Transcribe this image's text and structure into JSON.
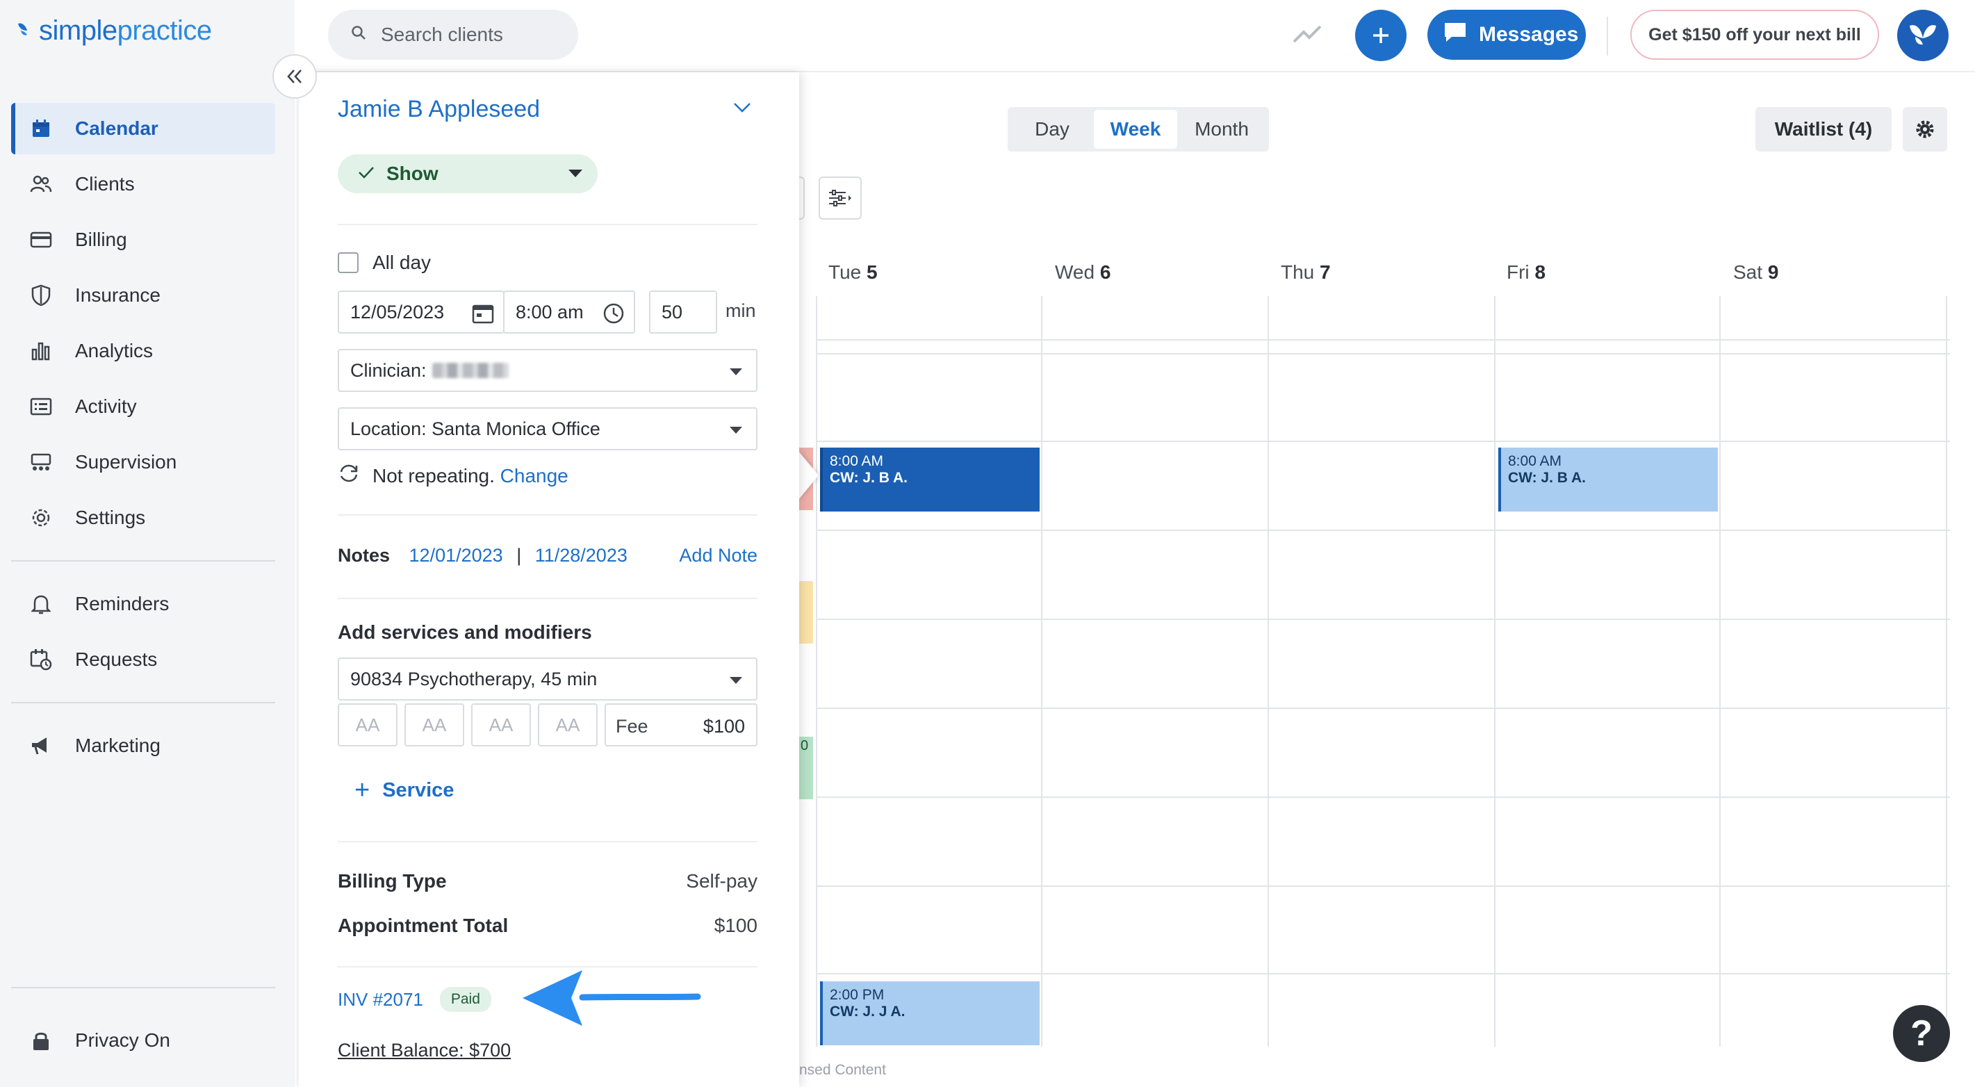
{
  "app": {
    "logo_text_a": "simple",
    "logo_text_b": "practice"
  },
  "sidebar": {
    "items": [
      {
        "label": "Calendar",
        "icon": "calendar-icon",
        "active": true
      },
      {
        "label": "Clients",
        "icon": "users-icon"
      },
      {
        "label": "Billing",
        "icon": "credit-card-icon"
      },
      {
        "label": "Insurance",
        "icon": "shield-icon"
      },
      {
        "label": "Analytics",
        "icon": "bar-chart-icon"
      },
      {
        "label": "Activity",
        "icon": "list-icon"
      },
      {
        "label": "Supervision",
        "icon": "supervision-icon"
      },
      {
        "label": "Settings",
        "icon": "gear-icon"
      }
    ],
    "secondary": [
      {
        "label": "Reminders",
        "icon": "bell-icon"
      },
      {
        "label": "Requests",
        "icon": "calendar-clock-icon"
      }
    ],
    "tertiary": [
      {
        "label": "Marketing",
        "icon": "megaphone-icon"
      }
    ],
    "privacy_label": "Privacy On"
  },
  "topbar": {
    "search_placeholder": "Search clients",
    "messages_label": "Messages",
    "promo_label": "Get $150 off your next bill"
  },
  "calendar": {
    "views": [
      "Day",
      "Week",
      "Month"
    ],
    "selected_view": "Week",
    "waitlist_label": "Waitlist (4)",
    "days": [
      {
        "dow": "Tue",
        "num": "5"
      },
      {
        "dow": "Wed",
        "num": "6"
      },
      {
        "dow": "Thu",
        "num": "7"
      },
      {
        "dow": "Fri",
        "num": "8"
      },
      {
        "dow": "Sat",
        "num": "9"
      }
    ],
    "events": [
      {
        "time": "8:00 AM",
        "name": "CW: J. B A.",
        "day": "Tue",
        "style": "dark"
      },
      {
        "time": "8:00 AM",
        "name": "CW: J. B A.",
        "day": "Fri",
        "style": "light"
      },
      {
        "time": "2:00 PM",
        "name": "CW: J. J A.",
        "day": "Tue",
        "style": "light"
      }
    ],
    "partial_event_digit": "0",
    "footer_text": "nsed Content",
    "colors": {
      "event_dark": "#1a5fb3",
      "event_light": "#a9cdf0",
      "strip_red": "#f0b1aa",
      "strip_yellow": "#fbe3a8",
      "strip_green": "#b6e3c7"
    }
  },
  "appointment": {
    "client_name": "Jamie B Appleseed",
    "status": "Show",
    "all_day_label": "All day",
    "date": "12/05/2023",
    "time": "8:00 am",
    "duration": "50",
    "duration_unit": "min",
    "clinician_label": "Clinician:",
    "location": "Location: Santa Monica Office",
    "repeat_text": "Not repeating.",
    "repeat_link": "Change",
    "notes_label": "Notes",
    "note_date_1": "12/01/2023",
    "note_sep": "|",
    "note_date_2": "11/28/2023",
    "add_note": "Add Note",
    "services_title": "Add services and modifiers",
    "service": "90834 Psychotherapy, 45 min",
    "modifiers": [
      "AA",
      "AA",
      "AA",
      "AA"
    ],
    "fee_label": "Fee",
    "fee_value": "$100",
    "add_service_label": "Service",
    "billing_type_label": "Billing Type",
    "billing_type_value": "Self-pay",
    "total_label": "Appointment Total",
    "total_value": "$100",
    "invoice": "INV #2071",
    "invoice_status": "Paid",
    "client_balance": "Client Balance: $700"
  },
  "help_label": "?"
}
